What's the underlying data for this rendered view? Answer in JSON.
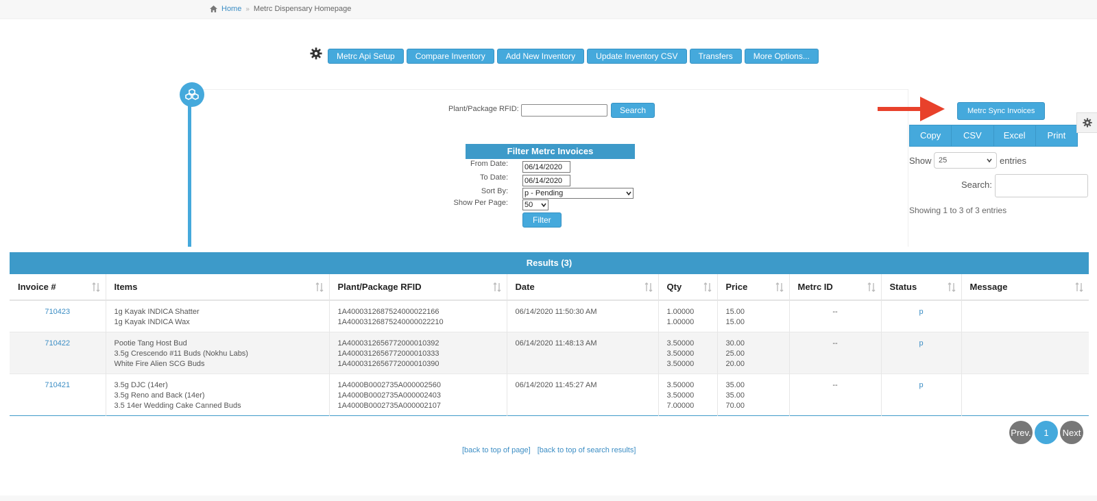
{
  "breadcrumb": {
    "home": "Home",
    "sep": "»",
    "current": "Metrc Dispensary Homepage"
  },
  "toolbar": {
    "buttons": [
      "Metrc Api Setup",
      "Compare Inventory",
      "Add New Inventory",
      "Update Inventory CSV",
      "Transfers",
      "More Options..."
    ]
  },
  "rfid_search": {
    "label": "Plant/Package RFID:",
    "value": "",
    "button": "Search"
  },
  "filter": {
    "title": "Filter Metrc Invoices",
    "from_label": "From Date:",
    "from_value": "06/14/2020",
    "to_label": "To Date:",
    "to_value": "06/14/2020",
    "sort_label": "Sort By:",
    "sort_value": "p - Pending",
    "perpage_label": "Show Per Page:",
    "perpage_value": "50",
    "button": "Filter"
  },
  "right_panel": {
    "sync_button": "Metrc Sync Invoices",
    "export_buttons": [
      "Copy",
      "CSV",
      "Excel",
      "Print"
    ],
    "show_label": "Show",
    "entries_value": "25",
    "entries_label": "entries",
    "search_label": "Search:",
    "showing_text": "Showing 1 to 3 of 3 entries"
  },
  "results": {
    "title": "Results (3)",
    "columns": [
      "Invoice #",
      "Items",
      "Plant/Package RFID",
      "Date",
      "Qty",
      "Price",
      "Metrc ID",
      "Status",
      "Message"
    ],
    "rows": [
      {
        "invoice": "710423",
        "items": [
          "1g Kayak INDICA Shatter",
          "1g Kayak INDICA Wax"
        ],
        "rfid": [
          "1A400031268752400002216​6",
          "1A40003126875240000022210"
        ],
        "date": "06/14/2020 11:50:30 AM",
        "qty": [
          "1.00000",
          "1.00000"
        ],
        "price": [
          "15.00",
          "15.00"
        ],
        "metrc_id": "--",
        "status": "p",
        "message": ""
      },
      {
        "invoice": "710422",
        "items": [
          "Pootie Tang Host Bud",
          "3.5g Crescendo #11 Buds (Nokhu Labs)",
          "White Fire Alien SCG Buds"
        ],
        "rfid": [
          "1A40003126567720000103​92",
          "1A40003126567720000103​33",
          "1A40003126567720000103​90"
        ],
        "date": "06/14/2020 11:48:13 AM",
        "qty": [
          "3.50000",
          "3.50000",
          "3.50000"
        ],
        "price": [
          "30.00",
          "25.00",
          "20.00"
        ],
        "metrc_id": "--",
        "status": "p",
        "message": ""
      },
      {
        "invoice": "710421",
        "items": [
          "3.5g DJC (14er)",
          "3.5g Reno and Back (14er)",
          "3.5 14er Wedding Cake Canned Buds"
        ],
        "rfid": [
          "1A4000B0002735A000002560",
          "1A4000B0002735A000002403",
          "1A4000B0002735A000002107"
        ],
        "date": "06/14/2020 11:45:27 AM",
        "qty": [
          "3.50000",
          "3.50000",
          "7.00000"
        ],
        "price": [
          "35.00",
          "35.00",
          "70.00"
        ],
        "metrc_id": "--",
        "status": "p",
        "message": ""
      }
    ]
  },
  "pagination": {
    "prev": "Prev.",
    "current": "1",
    "next": "Next"
  },
  "footer": {
    "top_page": "[back to top of page]",
    "top_results": "[back to top of search results]"
  },
  "colors": {
    "accent": "#45a9dc",
    "header": "#3d9ac9",
    "arrow": "#e8412b",
    "link": "#3b8dc4"
  },
  "icons": {
    "home": "home-icon",
    "gear": "gear-icon",
    "timeline": "cubes-icon",
    "sort": "sort-icon",
    "caret": "caret-down-icon",
    "arrow": "arrow-right-icon"
  }
}
